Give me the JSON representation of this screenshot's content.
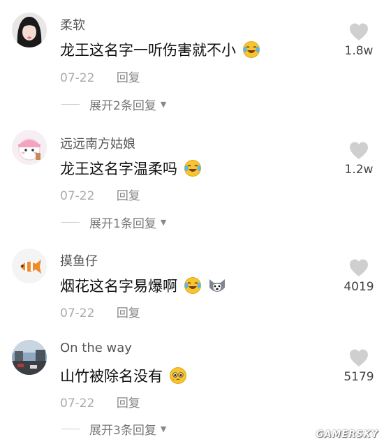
{
  "comments": [
    {
      "username": "柔软",
      "text": "龙王这名字一听伤害就不小",
      "emojis": [
        "laughing-tears-emoji"
      ],
      "date": "07-22",
      "reply_label": "回复",
      "likes": "1.8w",
      "expand_label": "展开2条回复"
    },
    {
      "username": "远远南方姑娘",
      "text": "龙王这名字温柔吗",
      "emojis": [
        "laughing-tears-emoji"
      ],
      "date": "07-22",
      "reply_label": "回复",
      "likes": "1.2w",
      "expand_label": "展开1条回复"
    },
    {
      "username": "摸鱼仔",
      "text": "烟花这名字易爆啊",
      "emojis": [
        "laughing-tears-emoji",
        "husky-dog-emoji"
      ],
      "date": "07-22",
      "reply_label": "回复",
      "likes": "4019"
    },
    {
      "username": "On the way",
      "text": "山竹被除名没有",
      "emojis": [
        "pleading-face-emoji"
      ],
      "date": "07-22",
      "reply_label": "回复",
      "likes": "5179",
      "expand_label": "展开3条回复"
    }
  ],
  "watermark": "GAMERSKY",
  "colors": {
    "heart": "#cfcfcf",
    "meta_text": "#aaaaaa",
    "emoji_yellow": "#f7c531"
  }
}
